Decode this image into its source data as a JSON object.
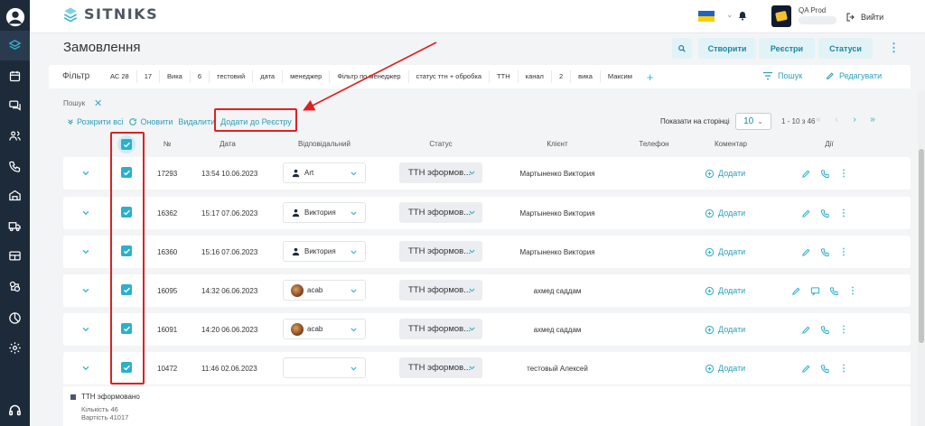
{
  "app": {
    "logo_text": "SITNIKS"
  },
  "header": {
    "account_name": "QA Prod",
    "logout_label": "Вийти",
    "brand_color": "#2bb0cc"
  },
  "page": {
    "title": "Замовлення",
    "buttons": {
      "create": "Створити",
      "registers": "Реєстри",
      "statuses": "Статуси"
    }
  },
  "filter": {
    "label": "Фільтр",
    "chips": [
      "АС 28",
      "17",
      "Вика",
      "6",
      "тестовий",
      "дата",
      "менеджер",
      "Фільтр по менеджер",
      "статус ттн + обробка",
      "ТТН",
      "канал",
      "2",
      "вика",
      "Максим"
    ],
    "search_label": "Пошук",
    "edit_label": "Редагувати"
  },
  "search_tag": "Пошук",
  "actions": {
    "expand_all": "Розкрити всі",
    "refresh": "Оновити",
    "delete": "Видалити",
    "add_to_register": "Додати до Реєстру"
  },
  "pagination": {
    "per_page_label": "Показати на сторінці",
    "per_page_value": "10",
    "range": "1 - 10 з 46"
  },
  "table": {
    "columns": [
      "№",
      "Дата",
      "Відповідальний",
      "Статус",
      "Клієнт",
      "Телефон",
      "Коментар",
      "Дії"
    ],
    "add_comment_label": "Додати",
    "rows": [
      {
        "id": "17293",
        "date": "13:54 10.06.2023",
        "responsible": "Art",
        "avatar": "user",
        "status": "ТТН эформов...",
        "client": "Мартыненко Виктория",
        "actions": "edit-phone"
      },
      {
        "id": "16362",
        "date": "15:17 07.06.2023",
        "responsible": "Виктория",
        "avatar": "user",
        "status": "ТТН эформов...",
        "client": "Мартыненко Виктория",
        "actions": "edit-phone"
      },
      {
        "id": "16360",
        "date": "15:16 07.06.2023",
        "responsible": "Виктория",
        "avatar": "user",
        "status": "ТТН эформов...",
        "client": "Мартыненко Виктория",
        "actions": "edit-phone"
      },
      {
        "id": "16095",
        "date": "14:32 06.06.2023",
        "responsible": "acab",
        "avatar": "photo",
        "status": "ТТН эформов...",
        "client": "ахмед саддам",
        "actions": "edit-chat-phone"
      },
      {
        "id": "16091",
        "date": "14:20 06.06.2023",
        "responsible": "acab",
        "avatar": "photo",
        "status": "ТТН эформов...",
        "client": "ахмед саддам",
        "actions": "edit-phone"
      },
      {
        "id": "10472",
        "date": "11:46 02.06.2023",
        "responsible": "",
        "avatar": "none",
        "status": "ТТН эформов...",
        "client": "тестовый Алексей",
        "actions": "edit-phone"
      }
    ]
  },
  "summary": {
    "status": "ТТН эформовано",
    "count": "Кількість 46",
    "total": "Вартість 41017"
  },
  "colors": {
    "accent": "#2bb0cc",
    "sidebar": "#1d2a3a",
    "annotation": "#e02020"
  }
}
